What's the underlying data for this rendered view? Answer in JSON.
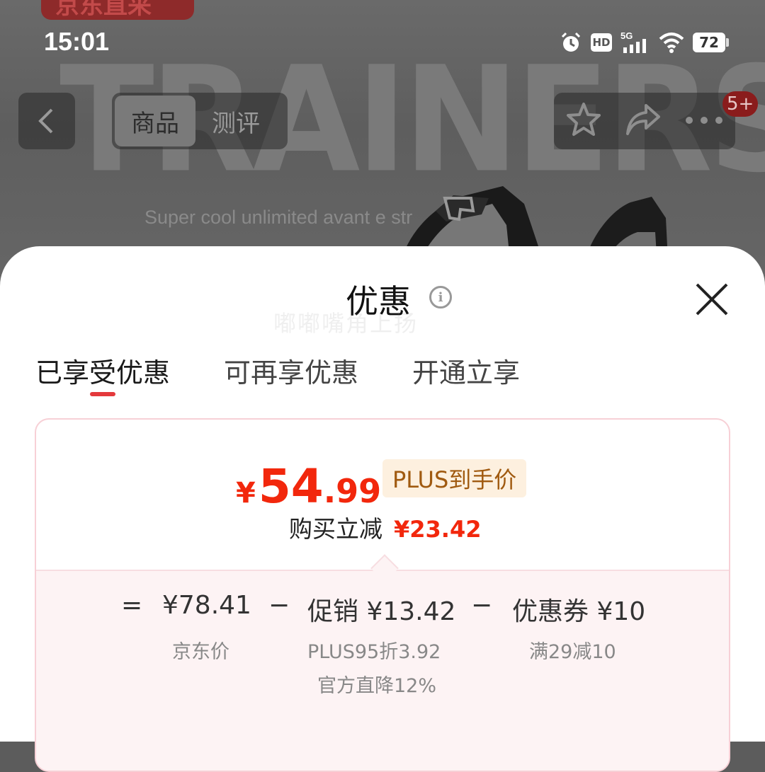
{
  "status_bar": {
    "time": "15:01",
    "hd": "HD",
    "network": "5G",
    "battery": "72"
  },
  "background": {
    "banner_text": "京东直采",
    "headline": "TRAINERS",
    "caption": "Super cool unlimited avant      e str"
  },
  "nav": {
    "tabs": [
      {
        "label": "商品",
        "active": true
      },
      {
        "label": "测评",
        "active": false
      }
    ],
    "badge": "5+"
  },
  "sheet": {
    "title": "优惠",
    "watermark": "嘟嘟嘴角上扬",
    "tabs": [
      {
        "label": "已享受优惠",
        "active": true
      },
      {
        "label": "可再享优惠",
        "active": false
      },
      {
        "label": "开通立享",
        "active": false
      }
    ],
    "price": {
      "symbol": "¥",
      "integer": "54",
      "decimal": ".99",
      "tag": "PLUS到手价"
    },
    "reduce": {
      "label": "购买立减",
      "value": "¥23.42"
    },
    "breakdown": {
      "eq": "=",
      "jd_price": "¥78.41",
      "jd_price_label": "京东价",
      "minus1": "−",
      "promo": "促销 ¥13.42",
      "promo_sub1": "PLUS95折3.92",
      "promo_sub2": "官方直降12%",
      "minus2": "−",
      "coupon": "优惠券 ¥10",
      "coupon_sub": "满29减10"
    }
  },
  "colors": {
    "accent": "#f2270c",
    "underline": "#e4393c",
    "tag_bg": "#fdf0df",
    "tag_text": "#a05a10"
  }
}
